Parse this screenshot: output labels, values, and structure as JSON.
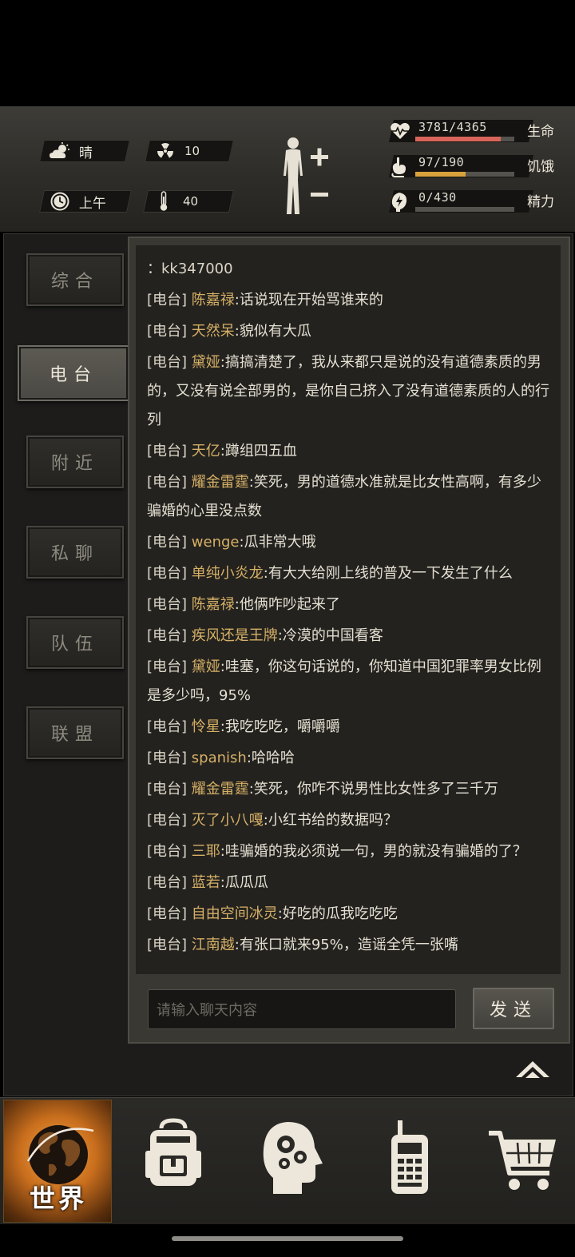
{
  "status": {
    "weather": {
      "icon": "cloud-sun-icon",
      "value": "晴"
    },
    "radiation": {
      "icon": "radiation-icon",
      "value": "10"
    },
    "time_of_day": {
      "icon": "clock-icon",
      "value": "上午"
    },
    "temperature": {
      "icon": "thermometer-icon",
      "value": "40"
    }
  },
  "vitals": [
    {
      "name": "health",
      "icon": "heart-pulse-icon",
      "value": "3781/4365",
      "label": "生命",
      "fraction": 0.866,
      "color": "#d9655a"
    },
    {
      "name": "hunger",
      "icon": "stomach-icon",
      "value": "97/190",
      "label": "饥饿",
      "fraction": 0.51,
      "color": "#d9a13c"
    },
    {
      "name": "energy",
      "icon": "energy-icon",
      "value": "0/430",
      "label": "精力",
      "fraction": 0.0,
      "color": "#7fb0d9"
    }
  ],
  "tabs": [
    {
      "id": "general",
      "label": "综合",
      "active": false
    },
    {
      "id": "radio",
      "label": "电台",
      "active": true
    },
    {
      "id": "nearby",
      "label": "附近",
      "active": false
    },
    {
      "id": "private",
      "label": "私聊",
      "active": false
    },
    {
      "id": "team",
      "label": "队伍",
      "active": false
    },
    {
      "id": "alliance",
      "label": "联盟",
      "active": false
    }
  ],
  "chat": {
    "first_line": "：kk347000",
    "messages": [
      {
        "channel": "[电台]",
        "name": "陈嘉禄",
        "text": ":话说现在开始骂谁来的"
      },
      {
        "channel": "[电台]",
        "name": "天然呆",
        "text": ":貌似有大瓜"
      },
      {
        "channel": "[电台]",
        "name": "黛娅",
        "text": ":搞搞清楚了，我从来都只是说的没有道德素质的男的，又没有说全部男的，是你自己挤入了没有道德素质的人的行列"
      },
      {
        "channel": "[电台]",
        "name": "天亿",
        "text": ":蹲组四五血"
      },
      {
        "channel": "[电台]",
        "name": "耀金雷霆",
        "text": ":笑死，男的道德水准就是比女性高啊，有多少骗婚的心里没点数"
      },
      {
        "channel": "[电台]",
        "name": "wenge",
        "text": ":瓜非常大哦"
      },
      {
        "channel": "[电台]",
        "name": "单纯小炎龙",
        "text": ":有大大给刚上线的普及一下发生了什么"
      },
      {
        "channel": "[电台]",
        "name": "陈嘉禄",
        "text": ":他俩咋吵起来了"
      },
      {
        "channel": "[电台]",
        "name": "疾风还是王牌",
        "text": ":冷漠的中国看客"
      },
      {
        "channel": "[电台]",
        "name": "黛娅",
        "text": ":哇塞，你这句话说的，你知道中国犯罪率男女比例是多少吗，95%"
      },
      {
        "channel": "[电台]",
        "name": "怜星",
        "text": ":我吃吃吃，嚼嚼嚼"
      },
      {
        "channel": "[电台]",
        "name": "spanish",
        "text": ":哈哈哈"
      },
      {
        "channel": "[电台]",
        "name": "耀金雷霆",
        "text": ":笑死，你咋不说男性比女性多了三千万"
      },
      {
        "channel": "[电台]",
        "name": "灭了小八嘎",
        "text": ":小红书给的数据吗？"
      },
      {
        "channel": "[电台]",
        "name": "三耶",
        "text": ":哇骗婚的我必须说一句，男的就没有骗婚的了？"
      },
      {
        "channel": "[电台]",
        "name": "蓝若",
        "text": ":瓜瓜瓜"
      },
      {
        "channel": "[电台]",
        "name": "自由空间冰灵",
        "text": ":好吃的瓜我吃吃吃"
      },
      {
        "channel": "[电台]",
        "name": "江南越",
        "text": ":有张口就来95%，造谣全凭一张嘴"
      }
    ],
    "input_placeholder": "请输入聊天内容",
    "send_label": "发送"
  },
  "bottom_nav": {
    "world_label": "世界",
    "items": [
      {
        "id": "world",
        "icon": "globe-icon",
        "active": true
      },
      {
        "id": "backpack",
        "icon": "backpack-icon",
        "active": false
      },
      {
        "id": "skills",
        "icon": "head-gears-icon",
        "active": false
      },
      {
        "id": "radio",
        "icon": "walkie-talkie-icon",
        "active": false
      },
      {
        "id": "shop",
        "icon": "shopping-cart-icon",
        "active": false
      }
    ]
  }
}
